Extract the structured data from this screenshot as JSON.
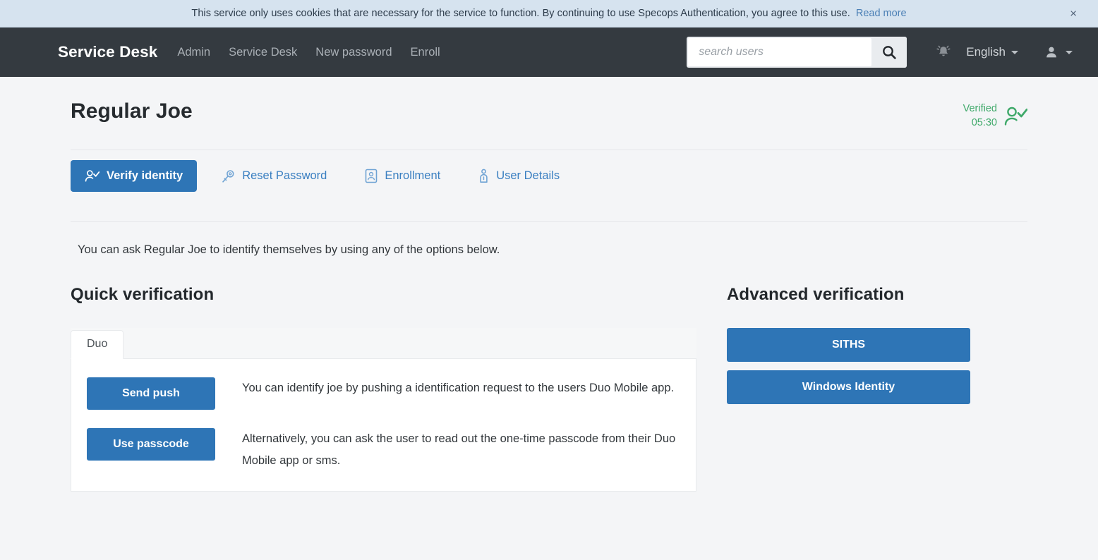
{
  "cookie_banner": {
    "text": "This service only uses cookies that are necessary for the service to function. By continuing to use Specops Authentication, you agree to this use.",
    "link_label": "Read more",
    "close_label": "×",
    "background": "#d6e3ef",
    "link_color": "#4a7fb5"
  },
  "navbar": {
    "brand": "Service Desk",
    "background": "#343a40",
    "links": [
      {
        "label": "Admin",
        "name": "nav-link-admin"
      },
      {
        "label": "Service Desk",
        "name": "nav-link-service-desk"
      },
      {
        "label": "New password",
        "name": "nav-link-new-password"
      },
      {
        "label": "Enroll",
        "name": "nav-link-enroll"
      }
    ],
    "search": {
      "placeholder": "search users",
      "value": "",
      "button_icon": "search-icon"
    },
    "bell_icon": "notification-bell-icon",
    "language": "English",
    "user_icon": "user-avatar-icon"
  },
  "user_page": {
    "title": "Regular Joe",
    "status": {
      "label": "Verified",
      "time": "05:30",
      "color": "#3fa96a",
      "icon": "user-verified-icon"
    },
    "tabs": [
      {
        "label": "Verify identity",
        "icon": "user-check-icon",
        "active": true
      },
      {
        "label": "Reset Password",
        "icon": "key-icon",
        "active": false
      },
      {
        "label": "Enrollment",
        "icon": "id-card-icon",
        "active": false
      },
      {
        "label": "User Details",
        "icon": "user-info-icon",
        "active": false
      }
    ],
    "intro": "You can ask Regular Joe to identify themselves by using any of the options below.",
    "quick_verification": {
      "heading": "Quick verification",
      "provider_tabs": [
        {
          "label": "Duo",
          "active": true
        }
      ],
      "options": [
        {
          "button_label": "Send push",
          "description": "You can identify joe by pushing a identification request to the users Duo Mobile app."
        },
        {
          "button_label": "Use passcode",
          "description": "Alternatively, you can ask the user to read out the one-time passcode from their Duo Mobile app or sms."
        }
      ]
    },
    "advanced_verification": {
      "heading": "Advanced verification",
      "buttons": [
        {
          "label": "SITHS"
        },
        {
          "label": "Windows Identity"
        }
      ],
      "accent": "#2e75b6"
    }
  }
}
